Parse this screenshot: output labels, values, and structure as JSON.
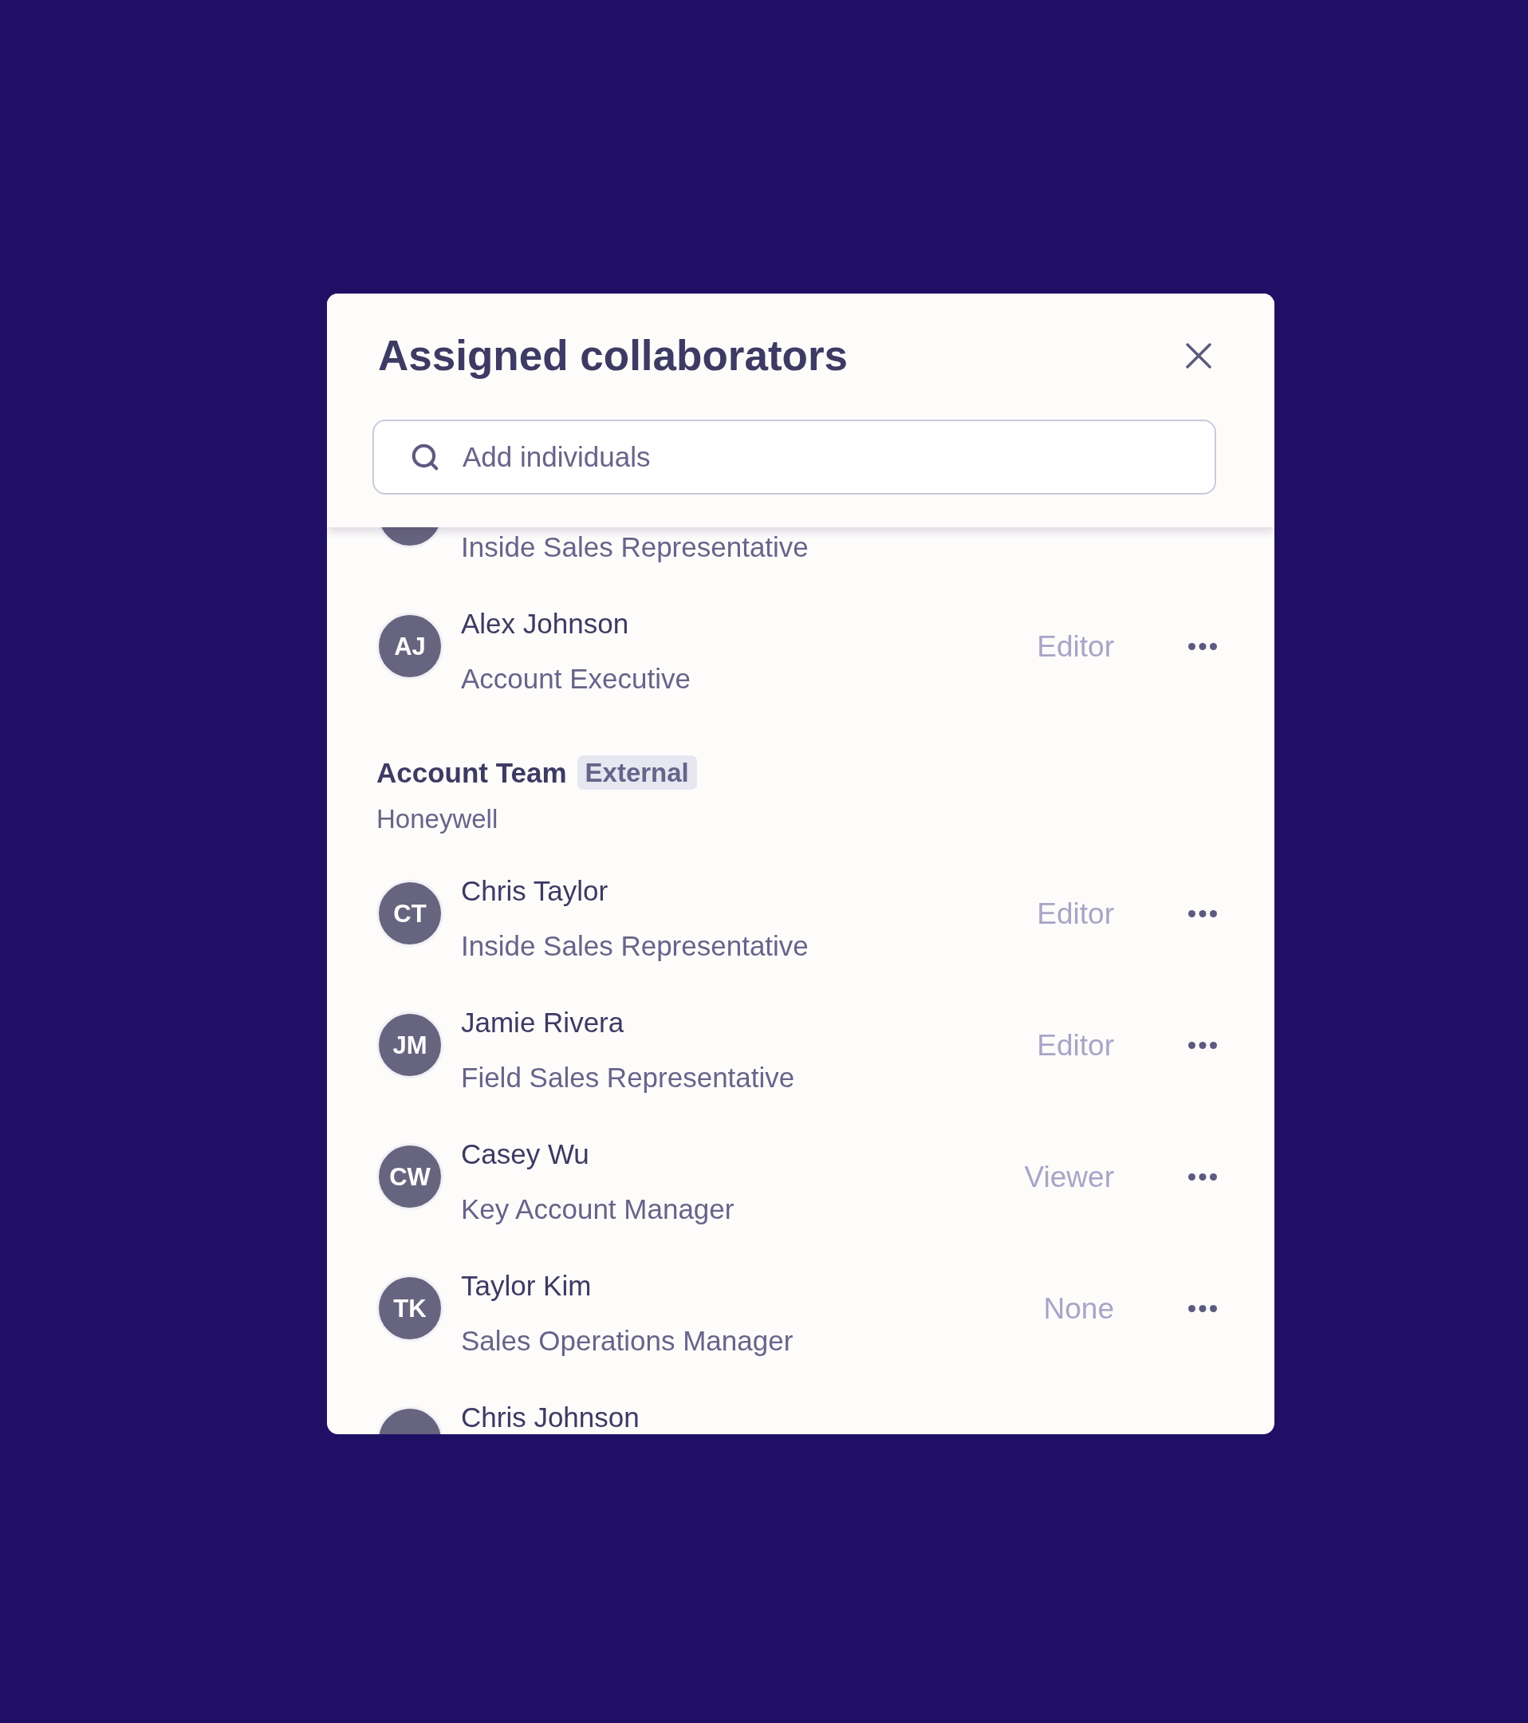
{
  "dialog": {
    "title": "Assigned collaborators"
  },
  "search": {
    "placeholder": "Add individuals"
  },
  "groups": [
    {
      "members": [
        {
          "role": "Inside Sales Representative"
        },
        {
          "initials": "AJ",
          "name": "Alex Johnson",
          "role": "Account Executive",
          "access": "Editor"
        }
      ]
    },
    {
      "title": "Account Team",
      "tag": "External",
      "organization": "Honeywell",
      "members": [
        {
          "initials": "CT",
          "name": "Chris Taylor",
          "role": "Inside Sales Representative",
          "access": "Editor"
        },
        {
          "initials": "JM",
          "name": "Jamie Rivera",
          "role": "Field Sales Representative",
          "access": "Editor"
        },
        {
          "initials": "CW",
          "name": "Casey Wu",
          "role": "Key Account Manager",
          "access": "Viewer"
        },
        {
          "initials": "TK",
          "name": "Taylor Kim",
          "role": "Sales Operations Manager",
          "access": "None"
        },
        {
          "name": "Chris Johnson"
        }
      ]
    }
  ]
}
